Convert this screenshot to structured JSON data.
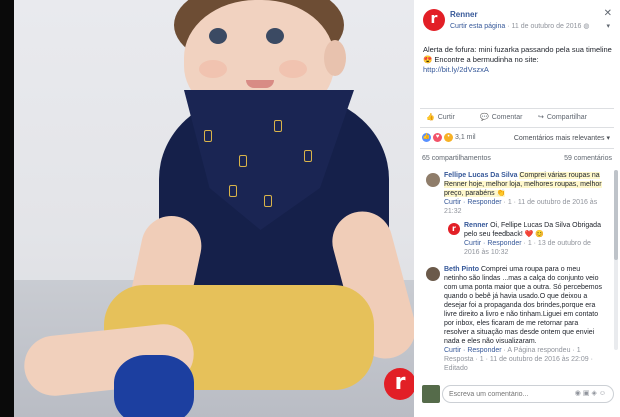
{
  "page": {
    "name": "Renner",
    "follow_label": "Curtir esta página",
    "date": "11 de outubro de 2016",
    "brand_color": "#e21f26",
    "link_color": "#365899"
  },
  "post": {
    "text": "Alerta de fofura: mini fuzarka passando pela sua timeline 😍 Encontre a bermudinha no site:",
    "link": "http://bit.ly/2dVszxA"
  },
  "actions": {
    "like": "Curtir",
    "comment": "Comentar",
    "share": "Compartilhar"
  },
  "reactions": {
    "count": "3,1 mil",
    "sort_label": "Comentários mais relevantes"
  },
  "stats": {
    "shares": "65 compartilhamentos",
    "comments": "59 comentários"
  },
  "comments": [
    {
      "author": "Fellipe Lucas Da Silva",
      "text": "Comprei várias roupas na Renner hoje, melhor loja, melhores roupas, melhor preço, parabéns 👏",
      "reply_label": "Curtir · Responder",
      "meta": "1 · 11 de outubro de 2016 às 21:32"
    },
    {
      "author": "Renner",
      "text": "Oi, Fellipe Lucas Da Silva Obrigada pelo seu feedback! ❤️ 😊",
      "reply_label": "Curtir · Responder",
      "meta": "1 · 13 de outubro de 2016 às 10:32"
    },
    {
      "author": "Beth Pinto",
      "text": "Comprei uma roupa para o meu netinho são lindas ...mas a calça do conjunto veio com uma ponta maior que a outra. Só percebemos quando o bebê já havia usado.O que deixou a desejar foi a propaganda dos brindes,porque era livre direito a livro e não tinham.Liguei em contato por inbox, eles ficaram de me retornar para resolver a situação mas desde ontem que enviei nada e eles não visualizaram.",
      "reply_label": "Curtir · Responder",
      "meta": "A Página respondeu · 1 Resposta · 1 · 11 de outubro de 2016 às 22:09 · Editado"
    }
  ],
  "composer": {
    "placeholder": "Escreva um comentário...",
    "icons": [
      "camera-icon",
      "gif-icon",
      "sticker-icon",
      "emoji-icon"
    ]
  },
  "photo": {
    "badge_letter": "r"
  }
}
